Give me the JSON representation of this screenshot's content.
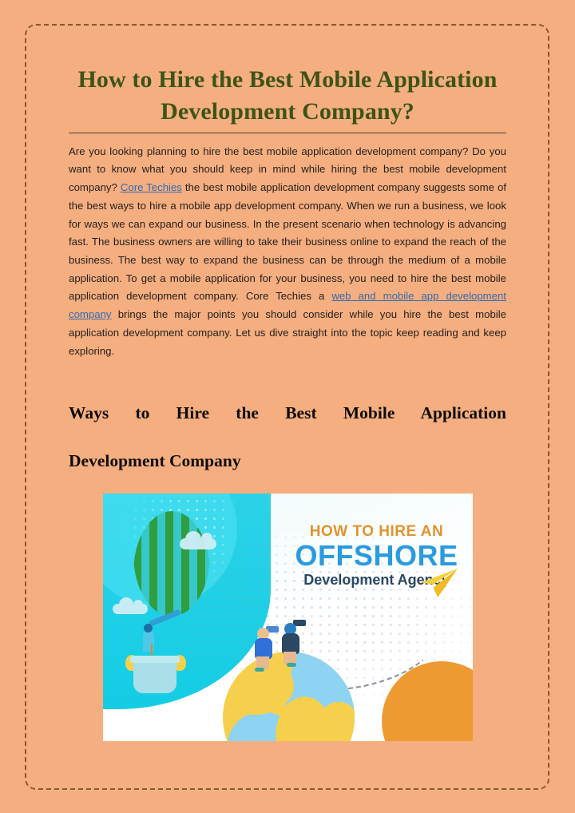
{
  "slide": {
    "background_color": "#f5ae80",
    "frame_color": "#8a5a2b"
  },
  "title": {
    "text": "How to Hire the Best Mobile Application Development Company?",
    "color": "#3e5416"
  },
  "intro": {
    "part1": "Are you looking planning to hire the best mobile application development company? Do you want to know what you should keep in mind while hiring the best mobile development company? ",
    "link1": "Core Techies",
    "part2": " the best mobile application development company suggests some of the best ways to hire a mobile app development company. When we run a business, we look for ways we can expand our business. In the present scenario when technology is advancing fast. The business owners are willing to take their business online to expand the reach of the business. The best way to expand the business can be through the medium of a mobile application. To get a mobile application for your business, you need to hire the best mobile application development company. Core Techies a ",
    "link2": "web and mobile app development company",
    "part3": " brings the major points you should consider while you hire the best mobile application development company. Let us dive straight into the topic keep reading and keep exploring.",
    "link_color": "#2f6cb2"
  },
  "section_heading": {
    "line1": "Ways to Hire the Best Mobile Application",
    "line2": "Development Company",
    "color": "#0d0b09"
  },
  "illustration": {
    "headline_line1": "HOW TO HIRE AN",
    "headline_line2": "OFFSHORE",
    "headline_line3": "Development Agency",
    "headline_line1_color": "#e0932c",
    "headline_line2_color": "#2a9bdf",
    "headline_line3_color": "#2a4763",
    "accent_cyan": "#1ecfe6",
    "accent_orange": "#ed9a33",
    "accent_green": "#2e9e3f",
    "accent_yellow": "#f6d04d"
  }
}
